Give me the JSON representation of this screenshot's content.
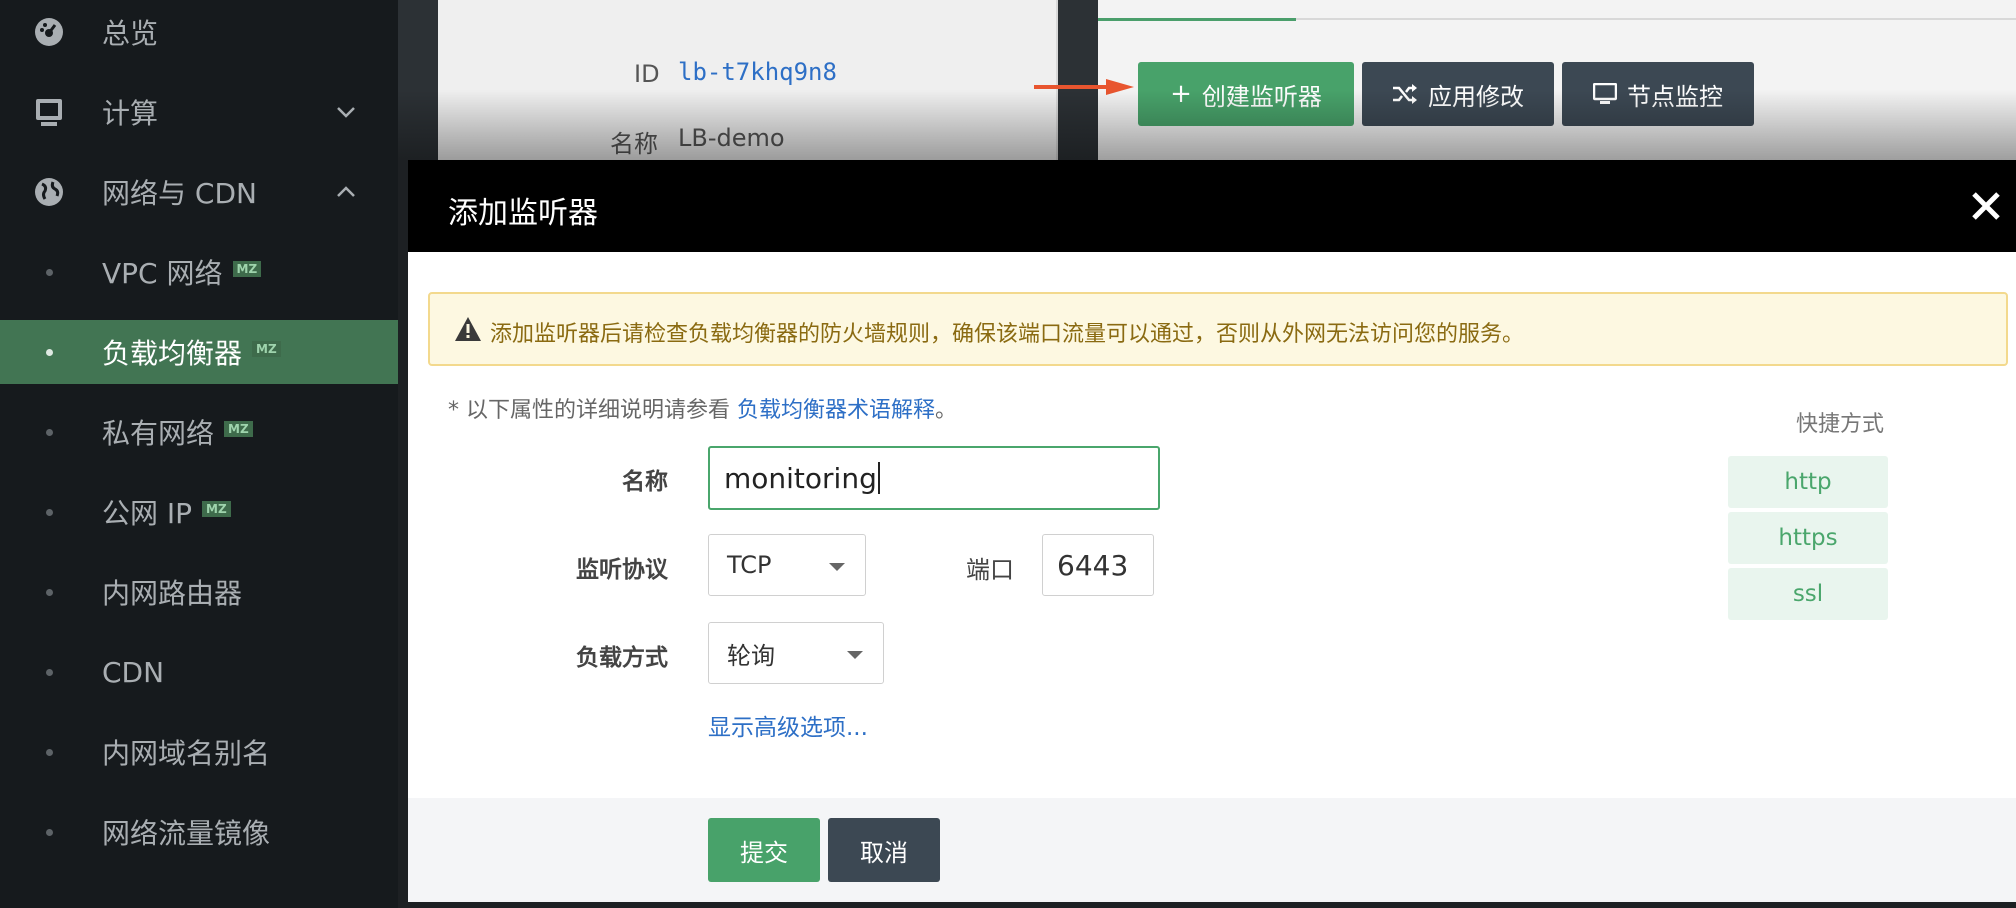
{
  "sidebar": {
    "items": [
      {
        "label": "总览",
        "icon": "dashboard-icon"
      },
      {
        "label": "计算",
        "icon": "monitor-icon"
      },
      {
        "label": "网络与 CDN",
        "icon": "globe-icon"
      },
      {
        "label": "VPC 网络",
        "badge": "MZ"
      },
      {
        "label": "负载均衡器",
        "badge": "MZ"
      },
      {
        "label": "私有网络",
        "badge": "MZ"
      },
      {
        "label": "公网 IP",
        "badge": "MZ"
      },
      {
        "label": "内网路由器"
      },
      {
        "label": "CDN"
      },
      {
        "label": "内网域名别名"
      },
      {
        "label": "网络流量镜像"
      }
    ]
  },
  "background": {
    "id_label": "ID",
    "id_value": "lb-t7khq9n8",
    "name_label": "名称",
    "name_value": "LB-demo",
    "create_listener": "创建监听器",
    "apply_changes": "应用修改",
    "node_monitor": "节点监控"
  },
  "modal": {
    "title": "添加监听器",
    "alert": "添加监听器后请检查负载均衡器的防火墙规则，确保该端口流量可以通过，否则从外网无法访问您的服务。",
    "hint_prefix": "* 以下属性的详细说明请参看 ",
    "hint_link": "负载均衡器术语解释",
    "hint_suffix": "。",
    "name_label": "名称",
    "name_value": "monitoring",
    "protocol_label": "监听协议",
    "protocol_value": "TCP",
    "port_label": "端口",
    "port_value": "6443",
    "balance_label": "负载方式",
    "balance_value": "轮询",
    "advanced_link": "显示高级选项...",
    "shortcuts_title": "快捷方式",
    "shortcuts": [
      "http",
      "https",
      "ssl"
    ],
    "submit": "提交",
    "cancel": "取消"
  },
  "colors": {
    "accent": "#48a26a",
    "sidebar_active": "#427553",
    "dark_button": "#3c4853"
  }
}
